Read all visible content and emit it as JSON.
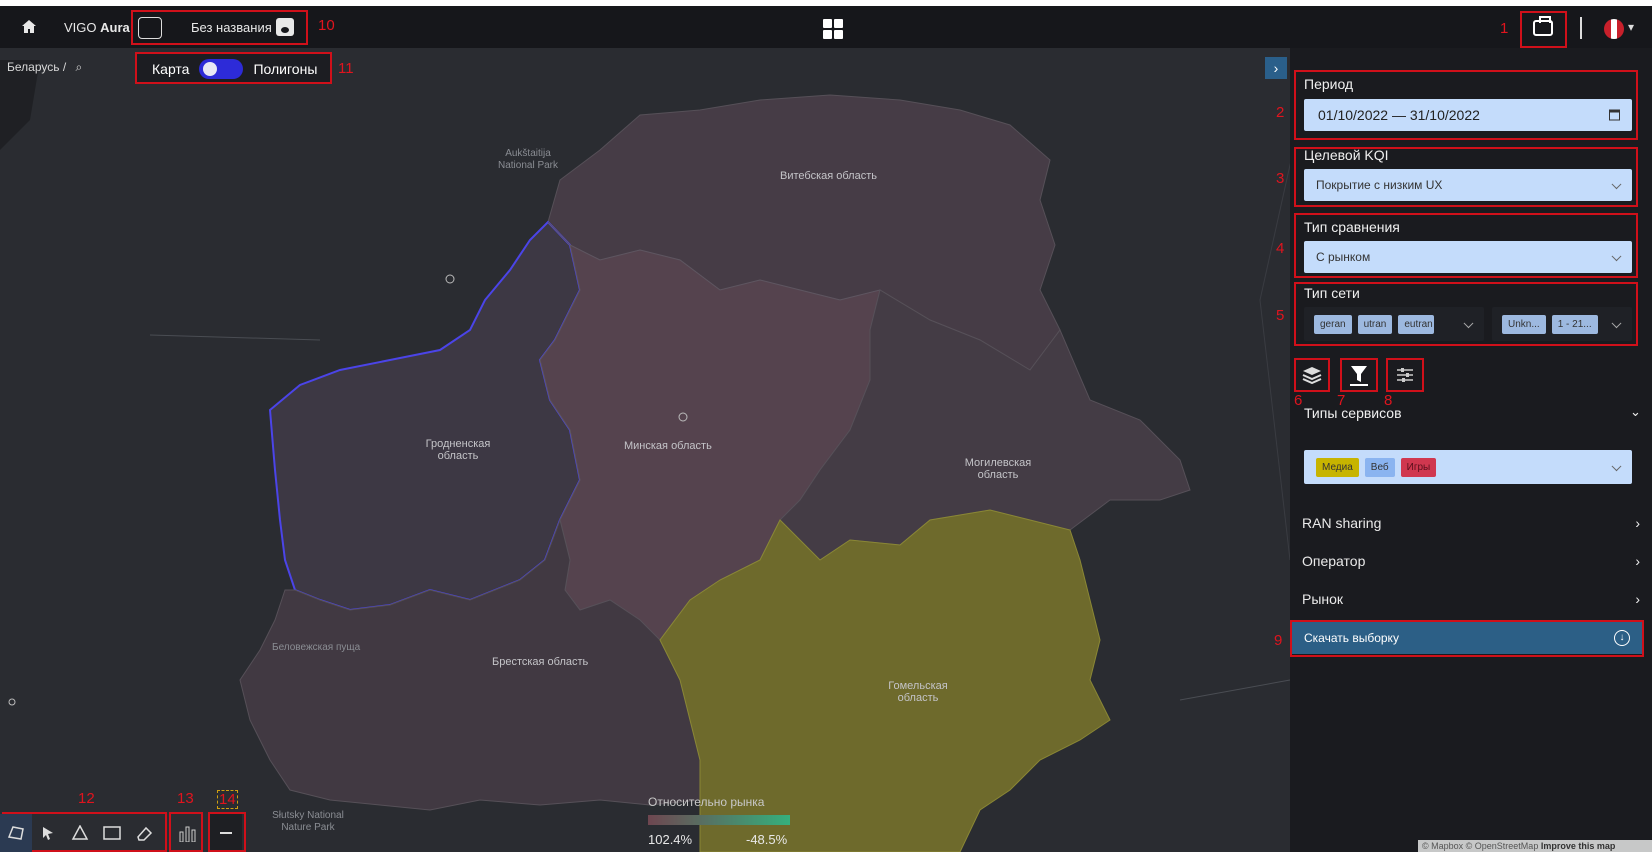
{
  "header": {
    "brand_prefix": "VIGO",
    "brand_name": "Aura",
    "project_name": "Без названия"
  },
  "breadcrumb": "Беларусь  /",
  "toggle": {
    "left_label": "Карта",
    "right_label": "Полигоны"
  },
  "map_labels": {
    "vitebsk": "Витебская область",
    "grodno": "Гродненская\nобласть",
    "minsk": "Минская область",
    "mogilev": "Могилевская\nобласть",
    "brest": "Брестская область",
    "gomel": "Гомельская\nобласть",
    "aukstaitija": "Aukštaitija\nNational Park",
    "belovezh": "Беловежская пуща",
    "slutsk": "Słutsky National\nNature Park"
  },
  "panel": {
    "period_title": "Период",
    "period_value": "01/10/2022 — 31/10/2022",
    "kqi_title": "Целевой KQI",
    "kqi_value": "Покрытие с низким UX",
    "compare_title": "Тип сравнения",
    "compare_value": "С рынком",
    "network_title": "Тип сети",
    "network_chips_a": [
      "geran",
      "utran",
      "eutran"
    ],
    "network_chips_b": [
      "Unkn...",
      "1 - 21..."
    ],
    "services_title": "Типы сервисов",
    "service_chips": [
      {
        "label": "Медиа",
        "color": "#c7b400"
      },
      {
        "label": "Веб",
        "color": "#8ab4f0"
      },
      {
        "label": "Игры",
        "color": "#d0374f"
      }
    ],
    "ran_sharing": "RAN sharing",
    "operator": "Оператор",
    "market": "Рынок",
    "download": "Скачать выборку"
  },
  "legend": {
    "title": "Относительно рынка",
    "min": "102.4%",
    "max": "-48.5%"
  },
  "attribution": {
    "text": "© Mapbox © OpenStreetMap",
    "link": "Improve this map"
  },
  "annotations": [
    "1",
    "2",
    "3",
    "4",
    "5",
    "6",
    "7",
    "8",
    "9",
    "10",
    "11",
    "12",
    "13",
    "14"
  ],
  "colors": {
    "accent_red": "#d0101a",
    "panel_field": "#c4dcfb",
    "region_default": "#4a3f48",
    "region_minsk": "#5a4650",
    "region_gomel": "#8a8a2e",
    "region_outline": "#4b44e8"
  }
}
